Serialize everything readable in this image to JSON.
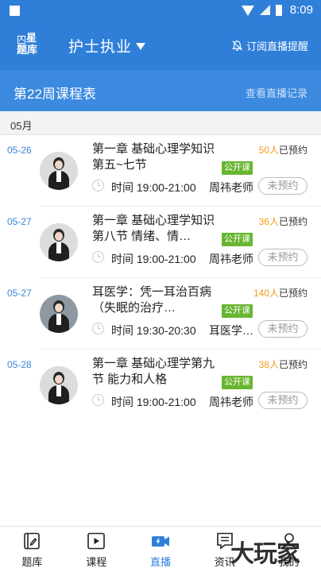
{
  "status_bar": {
    "time": "8:09"
  },
  "header": {
    "logo_line1": "星",
    "logo_line2": "题库",
    "title": "护士执业",
    "subscribe": "订阅直播提醒"
  },
  "week_bar": {
    "title": "第22周课程表",
    "link": "查看直播记录"
  },
  "month": "05月",
  "courses": [
    {
      "date": "05-26",
      "title": "第一章 基础心理学知识 第五~七节",
      "booked_num": "50人",
      "booked_suffix": "已预约",
      "tag": "公开课",
      "time": "时间 19:00-21:00",
      "teacher": "周祎老师",
      "button": "未预约"
    },
    {
      "date": "05-27",
      "title": "第一章 基础心理学知识 第八节 情绪、情…",
      "booked_num": "36人",
      "booked_suffix": "已预约",
      "tag": "公开课",
      "time": "时间 19:00-21:00",
      "teacher": "周祎老师",
      "button": "未预约"
    },
    {
      "date": "05-27",
      "title": "耳医学：凭一耳治百病（失眠的治疗…",
      "booked_num": "140人",
      "booked_suffix": "已预约",
      "tag": "公开课",
      "time": "时间 19:30-20:30",
      "teacher": "耳医学…",
      "button": "未预约"
    },
    {
      "date": "05-28",
      "title": "第一章 基础心理学第九节 能力和人格",
      "booked_num": "38人",
      "booked_suffix": "已预约",
      "tag": "公开课",
      "time": "时间 19:00-21:00",
      "teacher": "周祎老师",
      "button": "未预约"
    }
  ],
  "nav": [
    {
      "label": "题库",
      "icon": "question-bank-icon"
    },
    {
      "label": "课程",
      "icon": "course-play-icon"
    },
    {
      "label": "直播",
      "icon": "live-video-icon",
      "active": true
    },
    {
      "label": "资讯",
      "icon": "news-icon"
    },
    {
      "label": "我的",
      "icon": "profile-icon"
    }
  ],
  "watermark": "大玩家",
  "colors": {
    "primary": "#2f7fd9",
    "accent_orange": "#f39c1a",
    "tag_green": "#67b530"
  }
}
